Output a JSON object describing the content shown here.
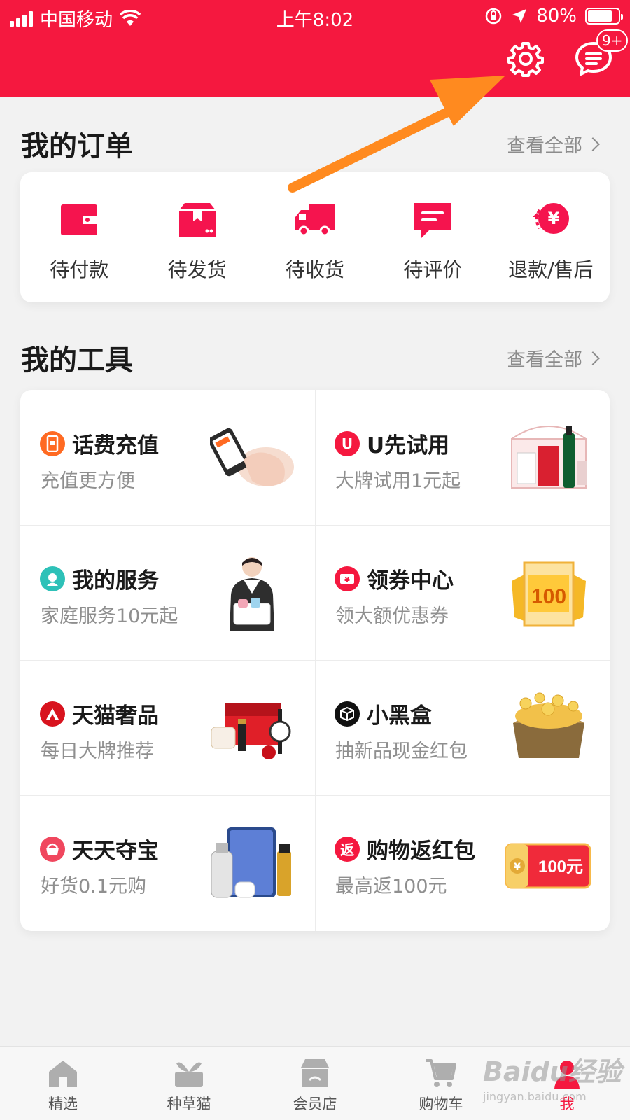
{
  "status_bar": {
    "carrier": "中国移动",
    "time": "上午8:02",
    "battery": "80%",
    "battery_level": 0.8
  },
  "header": {
    "message_badge": "9+"
  },
  "orders": {
    "title": "我的订单",
    "view_all": "查看全部",
    "items": [
      {
        "label": "待付款",
        "icon": "wallet-icon"
      },
      {
        "label": "待发货",
        "icon": "package-icon"
      },
      {
        "label": "待收货",
        "icon": "delivery-truck-icon"
      },
      {
        "label": "待评价",
        "icon": "comment-icon"
      },
      {
        "label": "退款/售后",
        "icon": "refund-icon"
      }
    ]
  },
  "tools": {
    "title": "我的工具",
    "view_all": "查看全部",
    "items": [
      {
        "name": "话费充值",
        "subtitle": "充值更方便",
        "icon": "phone-recharge-icon",
        "color": "#ff6a22"
      },
      {
        "name": "U先试用",
        "subtitle": "大牌试用1元起",
        "icon": "u-trial-icon",
        "color": "#f5183f"
      },
      {
        "name": "我的服务",
        "subtitle": "家庭服务10元起",
        "icon": "service-icon",
        "color": "#2ec1b8"
      },
      {
        "name": "领券中心",
        "subtitle": "领大额优惠券",
        "icon": "coupon-icon",
        "color": "#f5183f"
      },
      {
        "name": "天猫奢品",
        "subtitle": "每日大牌推荐",
        "icon": "luxury-icon",
        "color": "#d8131e"
      },
      {
        "name": "小黑盒",
        "subtitle": "抽新品现金红包",
        "icon": "black-box-icon",
        "color": "#111111"
      },
      {
        "name": "天天夺宝",
        "subtitle": "好货0.1元购",
        "icon": "treasure-icon",
        "color": "#f0475e"
      },
      {
        "name": "购物返红包",
        "subtitle": "最高返100元",
        "icon": "cashback-icon",
        "color": "#f5183f"
      }
    ],
    "coupon_art_value": "100",
    "cashback_art_value": "100元"
  },
  "tabbar": {
    "items": [
      {
        "label": "精选",
        "icon": "home-icon"
      },
      {
        "label": "种草猫",
        "icon": "sprout-icon"
      },
      {
        "label": "会员店",
        "icon": "store-icon"
      },
      {
        "label": "购物车",
        "icon": "cart-icon"
      },
      {
        "label": "我",
        "icon": "profile-icon"
      }
    ]
  },
  "watermark": {
    "text": "Baidu经验",
    "sub": "jingyan.baidu.com"
  },
  "colors": {
    "brand_red": "#f5183f",
    "annotation_orange": "#ff8a1f",
    "background": "#f2f2f2"
  }
}
